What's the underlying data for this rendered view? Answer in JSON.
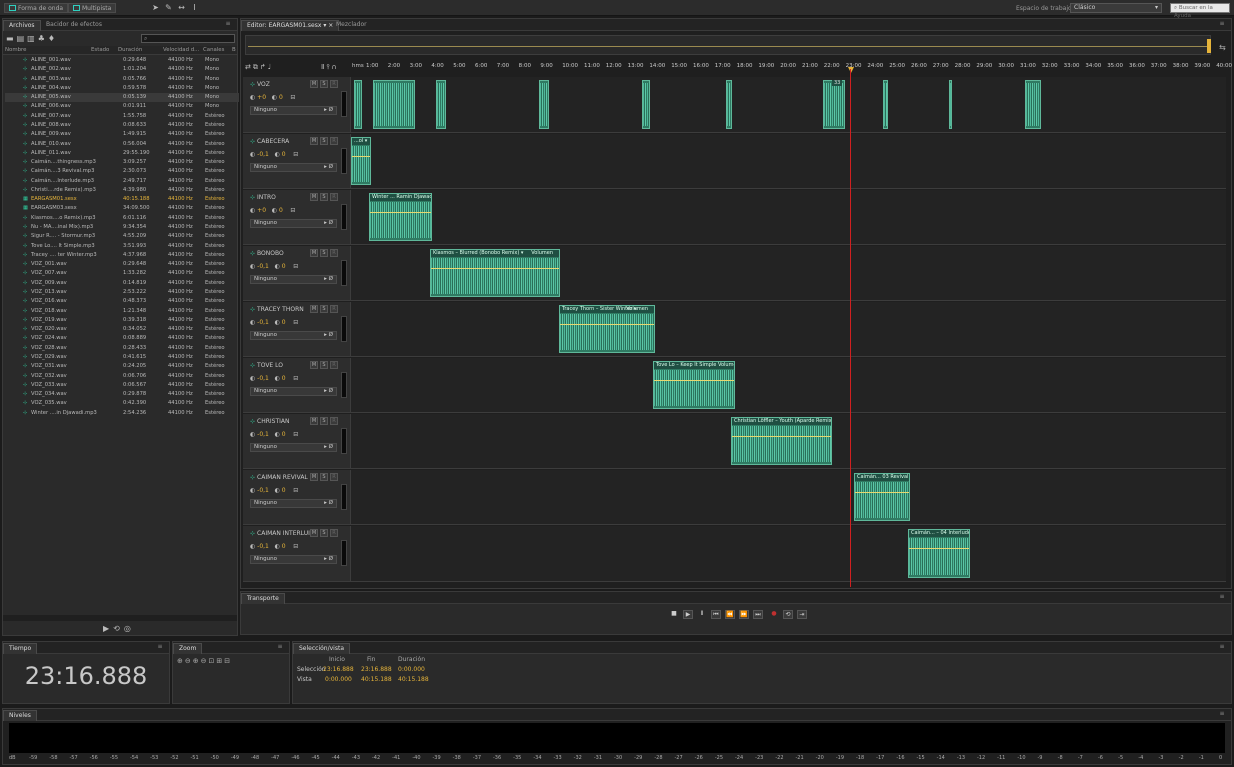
{
  "topbar": {
    "waveform_tab": "Forma de onda",
    "multitrack_tab": "Multipista",
    "workspace_label": "Espacio de trabajo:",
    "workspace_value": "Clásico",
    "help_search_placeholder": "Buscar en la Ayuda"
  },
  "files_panel": {
    "tabs": [
      "Archivos",
      "Bacidor de efectos"
    ],
    "columns": {
      "name": "Nombre",
      "status": "Estado",
      "duration": "Duración",
      "rate": "Velocidad d...",
      "channels": "Canales",
      "bits": "B"
    },
    "files": [
      {
        "name": "ALINE_001.wav",
        "duration": "0:29.648",
        "rate": "44100 Hz",
        "channels": "Mono"
      },
      {
        "name": "ALINE_002.wav",
        "duration": "1:01.204",
        "rate": "44100 Hz",
        "channels": "Mono"
      },
      {
        "name": "ALINE_003.wav",
        "duration": "0:05.766",
        "rate": "44100 Hz",
        "channels": "Mono"
      },
      {
        "name": "ALINE_004.wav",
        "duration": "0:59.578",
        "rate": "44100 Hz",
        "channels": "Mono"
      },
      {
        "name": "ALINE_005.wav",
        "duration": "0:05.139",
        "rate": "44100 Hz",
        "channels": "Mono"
      },
      {
        "name": "ALINE_006.wav",
        "duration": "0:01.911",
        "rate": "44100 Hz",
        "channels": "Mono"
      },
      {
        "name": "ALINE_007.wav",
        "duration": "1:55.758",
        "rate": "44100 Hz",
        "channels": "Estéreo"
      },
      {
        "name": "ALINE_008.wav",
        "duration": "0:08.633",
        "rate": "44100 Hz",
        "channels": "Estéreo"
      },
      {
        "name": "ALINE_009.wav",
        "duration": "1:49.915",
        "rate": "44100 Hz",
        "channels": "Estéreo"
      },
      {
        "name": "ALINE_010.wav",
        "duration": "0:56.004",
        "rate": "44100 Hz",
        "channels": "Estéreo"
      },
      {
        "name": "ALINE_011.wav",
        "duration": "29:55.190",
        "rate": "44100 Hz",
        "channels": "Estéreo"
      },
      {
        "name": "Caimán....thingness.mp3",
        "duration": "3:09.257",
        "rate": "44100 Hz",
        "channels": "Estéreo"
      },
      {
        "name": "Caimán....3 Revival.mp3",
        "duration": "2:30.073",
        "rate": "44100 Hz",
        "channels": "Estéreo"
      },
      {
        "name": "Caimán....Interlude.mp3",
        "duration": "2:49.717",
        "rate": "44100 Hz",
        "channels": "Estéreo"
      },
      {
        "name": "Christi....rde Remix).mp3",
        "duration": "4:39.980",
        "rate": "44100 Hz",
        "channels": "Estéreo"
      },
      {
        "name": "EARGASM01.sesx",
        "duration": "40:15.188",
        "rate": "44100 Hz",
        "channels": "Estéreo",
        "highlight": true
      },
      {
        "name": "EARGASM03.sesx",
        "duration": "34:09.500",
        "rate": "44100 Hz",
        "channels": "Estéreo"
      },
      {
        "name": "Kiasmos....o Remix).mp3",
        "duration": "6:01.116",
        "rate": "44100 Hz",
        "channels": "Estéreo"
      },
      {
        "name": "Nu - MA....inal Mix).mp3",
        "duration": "9:34.354",
        "rate": "44100 Hz",
        "channels": "Estéreo"
      },
      {
        "name": "Sigur R.... - Stormur.mp3",
        "duration": "4:55.209",
        "rate": "44100 Hz",
        "channels": "Estéreo"
      },
      {
        "name": "Tove Lo.... It Simple.mp3",
        "duration": "3:51.993",
        "rate": "44100 Hz",
        "channels": "Estéreo"
      },
      {
        "name": "Tracey .... ter Winter.mp3",
        "duration": "4:37.968",
        "rate": "44100 Hz",
        "channels": "Estéreo"
      },
      {
        "name": "VOZ_001.wav",
        "duration": "0:29.648",
        "rate": "44100 Hz",
        "channels": "Estéreo"
      },
      {
        "name": "VOZ_007.wav",
        "duration": "1:33.282",
        "rate": "44100 Hz",
        "channels": "Estéreo"
      },
      {
        "name": "VOZ_009.wav",
        "duration": "0:14.819",
        "rate": "44100 Hz",
        "channels": "Estéreo"
      },
      {
        "name": "VOZ_013.wav",
        "duration": "2:53.222",
        "rate": "44100 Hz",
        "channels": "Estéreo"
      },
      {
        "name": "VOZ_016.wav",
        "duration": "0:48.373",
        "rate": "44100 Hz",
        "channels": "Estéreo"
      },
      {
        "name": "VOZ_018.wav",
        "duration": "1:21.348",
        "rate": "44100 Hz",
        "channels": "Estéreo"
      },
      {
        "name": "VOZ_019.wav",
        "duration": "0:39.318",
        "rate": "44100 Hz",
        "channels": "Estéreo"
      },
      {
        "name": "VOZ_020.wav",
        "duration": "0:34.052",
        "rate": "44100 Hz",
        "channels": "Estéreo"
      },
      {
        "name": "VOZ_024.wav",
        "duration": "0:08.889",
        "rate": "44100 Hz",
        "channels": "Estéreo"
      },
      {
        "name": "VOZ_028.wav",
        "duration": "0:28.433",
        "rate": "44100 Hz",
        "channels": "Estéreo"
      },
      {
        "name": "VOZ_029.wav",
        "duration": "0:41.615",
        "rate": "44100 Hz",
        "channels": "Estéreo"
      },
      {
        "name": "VOZ_031.wav",
        "duration": "0:24.205",
        "rate": "44100 Hz",
        "channels": "Estéreo"
      },
      {
        "name": "VOZ_032.wav",
        "duration": "0:06.706",
        "rate": "44100 Hz",
        "channels": "Estéreo"
      },
      {
        "name": "VOZ_033.wav",
        "duration": "0:06.567",
        "rate": "44100 Hz",
        "channels": "Estéreo"
      },
      {
        "name": "VOZ_034.wav",
        "duration": "0:29.878",
        "rate": "44100 Hz",
        "channels": "Estéreo"
      },
      {
        "name": "VOZ_035.wav",
        "duration": "0:42.390",
        "rate": "44100 Hz",
        "channels": "Estéreo"
      },
      {
        "name": "Winter ....in Djawadi.mp3",
        "duration": "2:54.236",
        "rate": "44100 Hz",
        "channels": "Estéreo"
      }
    ]
  },
  "editor": {
    "tab": "Editor: EARGASM01.sesx",
    "mixer_tab": "Mezclador",
    "ruler_unit": "hms",
    "ruler_labels": [
      "1:00",
      "2:00",
      "3:00",
      "4:00",
      "5:00",
      "6:00",
      "7:00",
      "8:00",
      "9:00",
      "10:00",
      "11:00",
      "12:00",
      "13:00",
      "14:00",
      "15:00",
      "16:00",
      "17:00",
      "18:00",
      "19:00",
      "20:00",
      "21:00",
      "22:00",
      "23:00",
      "24:00",
      "25:00",
      "26:00",
      "27:00",
      "28:00",
      "29:00",
      "30:00",
      "31:00",
      "32:00",
      "33:00",
      "34:00",
      "35:00",
      "36:00",
      "37:00",
      "38:00",
      "39:00",
      "40:00"
    ],
    "tracks": [
      {
        "name": "VOZ",
        "vol": "+0",
        "pan": "0",
        "route": "Ninguno"
      },
      {
        "name": "CABECERA",
        "vol": "-0,1",
        "pan": "0",
        "route": "Ninguno"
      },
      {
        "name": "INTRO",
        "vol": "+0",
        "pan": "0",
        "route": "Ninguno"
      },
      {
        "name": "BONOBO",
        "vol": "-0,1",
        "pan": "0",
        "route": "Ninguno"
      },
      {
        "name": "TRACEY THORN",
        "vol": "-0,1",
        "pan": "0",
        "route": "Ninguno"
      },
      {
        "name": "TOVE LO",
        "vol": "-0,1",
        "pan": "0",
        "route": "Ninguno"
      },
      {
        "name": "CHRISTIAN",
        "vol": "-0,1",
        "pan": "0",
        "route": "Ninguno"
      },
      {
        "name": "CAIMAN REVIVAL",
        "vol": "-0,1",
        "pan": "0",
        "route": "Ninguno"
      },
      {
        "name": "CAIMAN INTERLUI",
        "vol": "-0,1",
        "pan": "0",
        "route": "Ninguno"
      }
    ],
    "clips": {
      "cabecera": "...ol",
      "intro": "Winter ... Ramin Djawadi",
      "bonobo": "Kiasmos – Blurred (Bonobo Remix)",
      "bonobo_vol": "Volumen",
      "tracey": "Tracey Thorn – Sister Winter",
      "tracey_vol": "Volumen",
      "tove": "Tove Lo – Keep It Simple Volumen",
      "christian": "Christian Löffler – Youth (Aparde Remix)",
      "revival": "Caimán... 03 Revival",
      "interlude": "Caimán... – 04 Interlude"
    },
    "playhead_label": "33"
  },
  "transport": {
    "title": "Transporte"
  },
  "time_panel": {
    "title": "Tiempo",
    "value": "23:16.888"
  },
  "zoom_panel": {
    "title": "Zoom"
  },
  "selection_panel": {
    "title": "Selección/vista",
    "col_start": "Inicio",
    "col_end": "Fin",
    "col_dur": "Duración",
    "row_sel": "Selección",
    "row_view": "Vista",
    "sel_start": "23:16.888",
    "sel_end": "23:16.888",
    "sel_dur": "0:00.000",
    "view_start": "0:00.000",
    "view_end": "40:15.188",
    "view_dur": "40:15.188"
  },
  "levels_panel": {
    "title": "Niveles",
    "scale": [
      "dB",
      "-59",
      "-58",
      "-57",
      "-56",
      "-55",
      "-54",
      "-53",
      "-52",
      "-51",
      "-50",
      "-49",
      "-48",
      "-47",
      "-46",
      "-45",
      "-44",
      "-43",
      "-42",
      "-41",
      "-40",
      "-39",
      "-38",
      "-37",
      "-36",
      "-35",
      "-34",
      "-33",
      "-32",
      "-31",
      "-30",
      "-29",
      "-28",
      "-27",
      "-26",
      "-25",
      "-24",
      "-23",
      "-22",
      "-21",
      "-20",
      "-19",
      "-18",
      "-17",
      "-16",
      "-15",
      "-14",
      "-13",
      "-12",
      "-11",
      "-10",
      "-9",
      "-8",
      "-7",
      "-6",
      "-5",
      "-4",
      "-3",
      "-2",
      "-1",
      "0"
    ]
  }
}
